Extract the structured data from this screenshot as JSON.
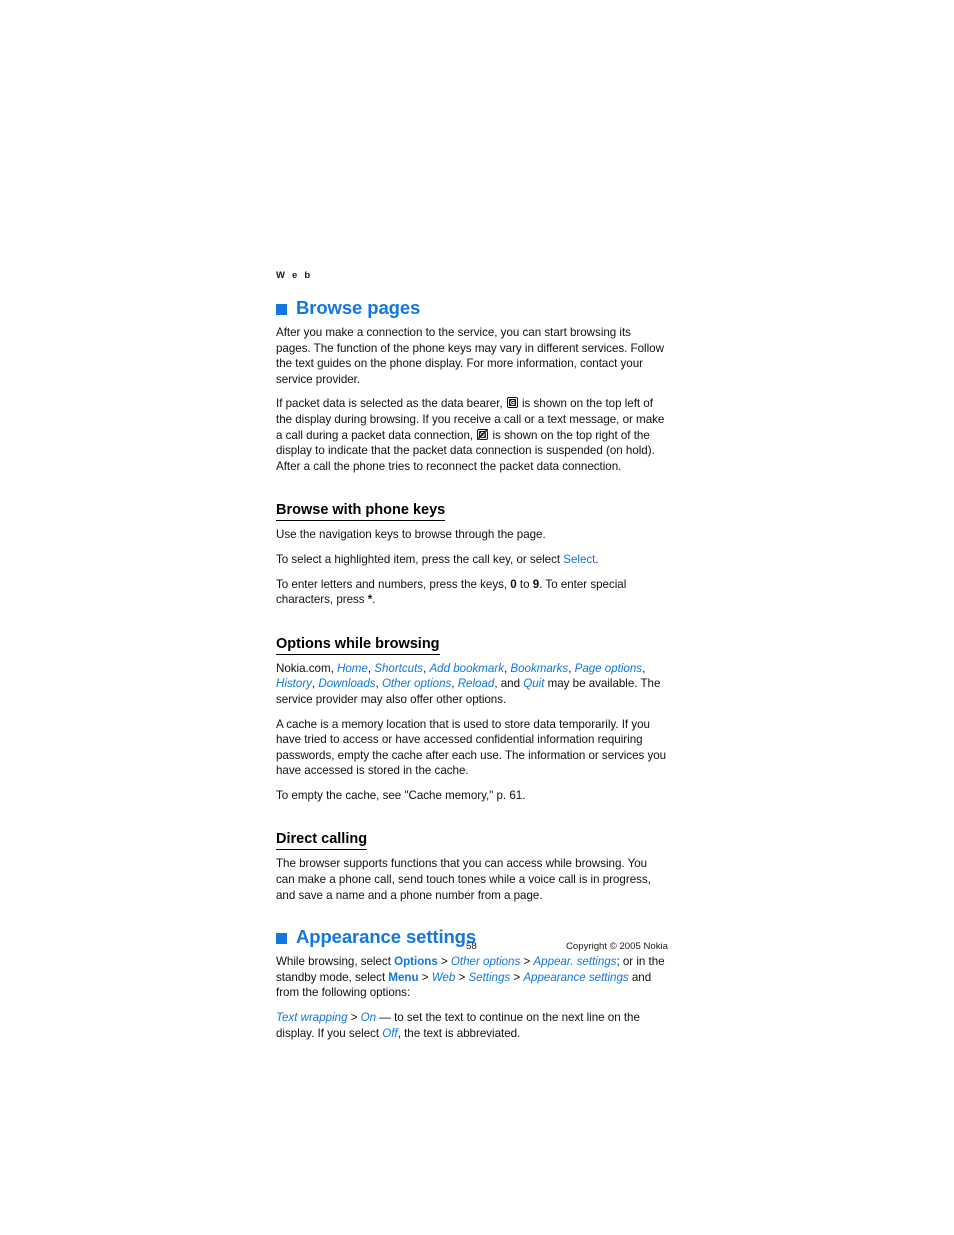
{
  "document": {
    "running_header": "W e b",
    "page_number": "58",
    "copyright": "Copyright © 2005 Nokia",
    "accent_color": "#1277e0",
    "text_color": "#111111",
    "background_color": "#ffffff"
  },
  "sections": {
    "browse_pages": {
      "heading": "Browse pages",
      "bullet_icon": "blue-square-bullet",
      "para1": "After you make a connection to the service, you can start browsing its pages. The function of the phone keys may vary in different services. Follow the text guides on the phone display. For more information, contact your service provider.",
      "para2_a": "If packet data is selected as the data bearer, ",
      "para2_icon1": "gprs-indicator-icon",
      "para2_b": " is shown on the top left of the display during browsing. If you receive a call or a text message, or make a call during a packet data connection, ",
      "para2_icon2": "gprs-suspended-icon",
      "para2_c": " is shown on the top right of the display to indicate that the packet data connection is suspended (on hold). After a call the phone tries to reconnect the packet data connection."
    },
    "browse_with_phone_keys": {
      "heading": "Browse with phone keys",
      "para1": "Use the navigation keys to browse through the page.",
      "para2_a": "To select a highlighted item, press the call key, or select ",
      "para2_link": "Select",
      "para2_b": ".",
      "para3_a": "To enter letters and numbers, press the keys, ",
      "para3_key0": "0",
      "para3_mid": " to ",
      "para3_key9": "9",
      "para3_b": ". To enter special characters, press ",
      "para3_star": "*",
      "para3_c": "."
    },
    "options_while_browsing": {
      "heading": "Options while browsing",
      "para1_prefix": "Nokia.com, ",
      "options": [
        "Home",
        "Shortcuts",
        "Add bookmark",
        "Bookmarks",
        "Page options",
        "History",
        "Downloads",
        "Other options",
        "Reload",
        "Quit"
      ],
      "para1_and": "and ",
      "para1_suffix": " may be available. The service provider may also offer other options.",
      "para2": "A cache is a memory location that is used to store data temporarily. If you have tried to access or have accessed confidential information requiring passwords, empty the cache after each use. The information or services you have accessed is stored in the cache.",
      "para3": "To empty the cache, see \"Cache memory,\" p. 61."
    },
    "direct_calling": {
      "heading": "Direct calling",
      "para1": "The browser supports functions that you can access while browsing. You can make a phone call, send touch tones while a voice call is in progress, and save a name and a phone number from a page."
    },
    "appearance_settings": {
      "heading": "Appearance settings",
      "bullet_icon": "blue-square-bullet",
      "para1_a": "While browsing, select ",
      "para1_options": "Options",
      "para1_sep1": " > ",
      "para1_other_options": "Other options",
      "para1_sep2": " > ",
      "para1_appear_settings": "Appear. settings",
      "para1_b": "; or in the standby mode, select ",
      "para1_menu": "Menu",
      "para1_sep3": " > ",
      "para1_web": "Web",
      "para1_sep4": " > ",
      "para1_settings": "Settings",
      "para1_sep5": " > ",
      "para1_appearance_settings": "Appearance settings",
      "para1_c": " and from the following options:",
      "para2_text_wrapping": "Text wrapping",
      "para2_sep": " > ",
      "para2_on": "On",
      "para2_a": " — to set the text to continue on the next line on the display. If you select ",
      "para2_off": "Off",
      "para2_b": ", the text is abbreviated."
    }
  }
}
